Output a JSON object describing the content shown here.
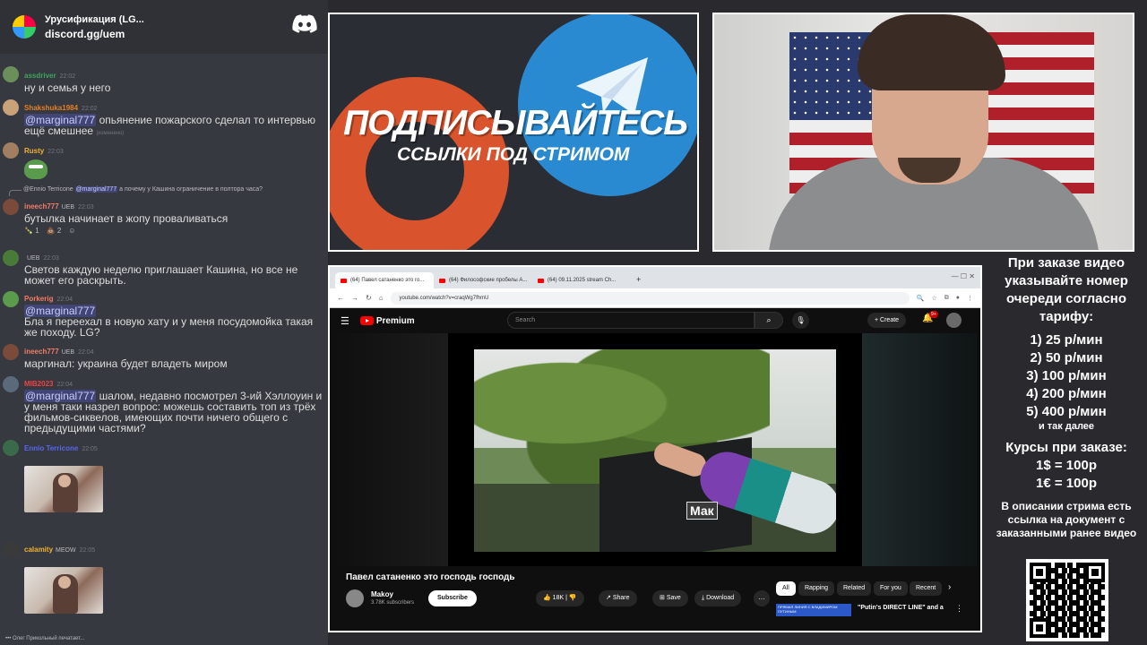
{
  "discord": {
    "server_name": "Урусификация (LG...",
    "invite": "discord.gg/uem",
    "messages": [
      {
        "user": "assdriver",
        "user_color": "#3ba55d",
        "time": "22:02",
        "text": "ну и семья у него"
      },
      {
        "user": "Shakshuka1984",
        "user_color": "#e67e22",
        "time": "22:02",
        "mention": "@marginal777",
        "text": "опьянение пожарского сделал то интервью ещё смешнее",
        "edited": "(изменено)"
      },
      {
        "user": "Rusty",
        "user_color": "#f0b232",
        "time": "22:03"
      },
      {
        "reply_user": "@Ennio Terricone",
        "reply_mention": "@marginal777",
        "reply_text": "а почему у Кашина ограничение в полтора часа?",
        "user": "ineech777",
        "user_color": "#f47b67",
        "badge": "UEB",
        "time": "22:03",
        "text": "бутылка начинает в жопу проваливаться",
        "reactions": [
          "1",
          "2"
        ]
      },
      {
        "user": "",
        "user_color": "#3ba55d",
        "badge": "UEB",
        "time": "22:03",
        "text": "Светов каждую неделю приглашает Кашина, но все не может его раскрыть."
      },
      {
        "user": "Porkerig",
        "user_color": "#f47b67",
        "time": "22:04",
        "mention": "@marginal777",
        "text": "Бла я переехал в новую хату и у меня посудомойка такая же походу. LG?"
      },
      {
        "user": "ineech777",
        "user_color": "#f47b67",
        "badge": "UEB",
        "time": "22:04",
        "text": "маргинал: украина будет владеть миром"
      },
      {
        "user": "MIB2023",
        "user_color": "#ed4245",
        "time": "22:04",
        "mention": "@marginal777",
        "text": "шалом, недавно посмотрел 3-ий Хэллоуин и у меня таки назрел вопрос: можешь составить топ из трёх фильмов-сиквелов, имеющих почти ничего общего с предыдущими частями?"
      },
      {
        "user": "Ennio Terricone",
        "user_color": "#5865f2",
        "time": "22:05"
      },
      {
        "user": "calamity",
        "user_color": "#f0b232",
        "badge": "MEOW",
        "time": "22:05"
      }
    ],
    "typing": "Олег Прикольный печатает..."
  },
  "promo": {
    "title": "ПОДПИСЫВАЙТЕСЬ",
    "subtitle": "ССЫЛКИ ПОД СТРИМОМ"
  },
  "browser": {
    "tabs": [
      {
        "label": "(64) Павел сатаненко это го..."
      },
      {
        "label": "(64) Философские пробелы А..."
      },
      {
        "label": "(64) 09.11.2025 stream Ch..."
      }
    ],
    "new_tab": "+",
    "url": "youtube.com/watch?v=craqWg7fhmU"
  },
  "youtube": {
    "logo_text": "Premium",
    "search_placeholder": "Search",
    "create_label": "Create",
    "notif_count": "9+",
    "video_title": "Павел сатаненко это господь господь",
    "channel_name": "Makoy",
    "channel_subs": "3.78K subscribers",
    "subscribe_label": "Subscribe",
    "like_count": "18K",
    "share_label": "Share",
    "save_label": "Save",
    "download_label": "Download",
    "video_badge": "Мак",
    "chips": [
      "All",
      "Rapping",
      "Related",
      "For you",
      "Recent"
    ],
    "rec_thumb_text": "ПРЯМАЯ ЛИНИЯ С ВЛАДИМИРОМ ПУТИНЫМ",
    "rec_title": "\"Putin's DIRECT LINE\" and a"
  },
  "info": {
    "heading": "При заказе видео указывайте номер очереди согласно тарифу:",
    "rates": [
      "1) 25 р/мин",
      "2) 50 р/мин",
      "3) 100 р/мин",
      "4) 200 р/мин",
      "5) 400 р/мин"
    ],
    "etc": "и так далее",
    "fx_title": "Курсы при заказе:",
    "fx": [
      "1$ = 100р",
      "1€ = 100р"
    ],
    "desc": "В описании стрима есть ссылка на документ с заказанными ранее видео"
  }
}
